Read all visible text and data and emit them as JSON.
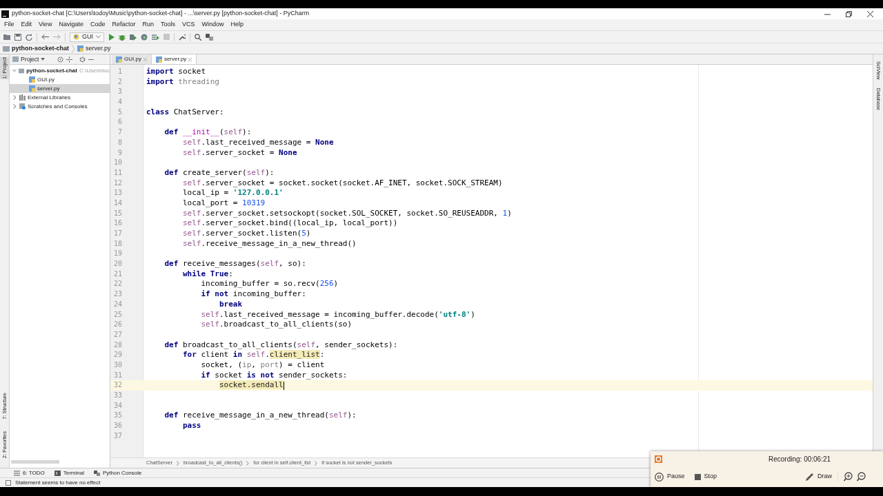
{
  "window": {
    "title": "python-socket-chat [C:\\Users\\todoy\\Music\\python-socket-chat] - ...\\server.py [python-socket-chat] - PyCharm"
  },
  "menu": [
    "File",
    "Edit",
    "View",
    "Navigate",
    "Code",
    "Refactor",
    "Run",
    "Tools",
    "VCS",
    "Window",
    "Help"
  ],
  "toolbar": {
    "run_config": "GUI"
  },
  "navigation_bar": [
    "python-socket-chat",
    "server.py"
  ],
  "left_stripe": [
    {
      "label": "1: Project",
      "selected": true
    },
    {
      "label": "7: Structure",
      "selected": false
    },
    {
      "label": "2: Favorites",
      "selected": false
    }
  ],
  "right_stripe": [
    "SciView",
    "Database"
  ],
  "project_panel": {
    "title": "Project",
    "tree": [
      {
        "label": "python-socket-chat",
        "path": "C:\\Users\\toc",
        "kind": "folder",
        "expanded": true,
        "selected": false,
        "children": [
          {
            "label": "GUI.py",
            "kind": "file",
            "selected": false
          },
          {
            "label": "server.py",
            "kind": "file",
            "selected": true
          }
        ]
      },
      {
        "label": "External Libraries",
        "kind": "libraries",
        "expanded": false,
        "selected": false
      },
      {
        "label": "Scratches and Consoles",
        "kind": "scratches",
        "expanded": false,
        "selected": false
      }
    ]
  },
  "editor_tabs": [
    {
      "label": "GUI.py",
      "selected": false
    },
    {
      "label": "server.py",
      "selected": true
    }
  ],
  "code": [
    {
      "n": "1",
      "tokens": [
        {
          "kind": "keyword",
          "text": "import"
        },
        {
          "kind": "plain",
          "text": " socket"
        }
      ]
    },
    {
      "n": "2",
      "tokens": [
        {
          "kind": "keyword",
          "text": "import"
        },
        {
          "kind": "unused",
          "text": " threading"
        }
      ]
    },
    {
      "n": "3"
    },
    {
      "n": "4"
    },
    {
      "n": "5",
      "tokens": [
        {
          "kind": "keyword",
          "text": "class"
        },
        {
          "kind": "plain",
          "text": " ChatServer:"
        }
      ]
    },
    {
      "n": "6"
    },
    {
      "n": "7",
      "tokens": [
        {
          "kind": "keyword",
          "text": "    def"
        },
        {
          "kind": "magic",
          "text": " __init__"
        },
        {
          "kind": "plain",
          "text": "("
        },
        {
          "kind": "self",
          "text": "self"
        },
        {
          "kind": "plain",
          "text": "):"
        }
      ]
    },
    {
      "n": "8",
      "tokens": [
        {
          "kind": "self",
          "text": "        self"
        },
        {
          "kind": "plain",
          "text": ".last_received_message = "
        },
        {
          "kind": "keyword",
          "text": "None"
        }
      ]
    },
    {
      "n": "9",
      "tokens": [
        {
          "kind": "self",
          "text": "        self"
        },
        {
          "kind": "plain",
          "text": ".server_socket = "
        },
        {
          "kind": "keyword",
          "text": "None"
        }
      ]
    },
    {
      "n": "10"
    },
    {
      "n": "11",
      "tokens": [
        {
          "kind": "keyword",
          "text": "    def"
        },
        {
          "kind": "plain",
          "text": " create_server("
        },
        {
          "kind": "self",
          "text": "self"
        },
        {
          "kind": "plain",
          "text": "):"
        }
      ]
    },
    {
      "n": "12",
      "tokens": [
        {
          "kind": "self",
          "text": "        self"
        },
        {
          "kind": "plain",
          "text": ".server_socket = socket.socket(socket.AF_INET, socket.SOCK_STREAM)"
        }
      ]
    },
    {
      "n": "13",
      "tokens": [
        {
          "kind": "plain",
          "text": "        local_ip = "
        },
        {
          "kind": "string",
          "text": "'127.0.0.1'"
        }
      ]
    },
    {
      "n": "14",
      "tokens": [
        {
          "kind": "plain",
          "text": "        local_port = "
        },
        {
          "kind": "number",
          "text": "10319"
        }
      ]
    },
    {
      "n": "15",
      "tokens": [
        {
          "kind": "self",
          "text": "        self"
        },
        {
          "kind": "plain",
          "text": ".server_socket.setsockopt(socket.SOL_SOCKET, socket.SO_REUSEADDR, "
        },
        {
          "kind": "number",
          "text": "1"
        },
        {
          "kind": "plain",
          "text": ")"
        }
      ]
    },
    {
      "n": "16",
      "tokens": [
        {
          "kind": "self",
          "text": "        self"
        },
        {
          "kind": "plain",
          "text": ".server_socket.bind((local_ip, local_port))"
        }
      ]
    },
    {
      "n": "17",
      "tokens": [
        {
          "kind": "self",
          "text": "        self"
        },
        {
          "kind": "plain",
          "text": ".server_socket.listen("
        },
        {
          "kind": "number",
          "text": "5"
        },
        {
          "kind": "plain",
          "text": ")"
        }
      ]
    },
    {
      "n": "18",
      "tokens": [
        {
          "kind": "self",
          "text": "        self"
        },
        {
          "kind": "plain",
          "text": ".receive_message_in_a_new_thread()"
        }
      ]
    },
    {
      "n": "19"
    },
    {
      "n": "20",
      "tokens": [
        {
          "kind": "keyword",
          "text": "    def"
        },
        {
          "kind": "plain",
          "text": " receive_messages("
        },
        {
          "kind": "self",
          "text": "self"
        },
        {
          "kind": "plain",
          "text": ", so):"
        }
      ]
    },
    {
      "n": "21",
      "tokens": [
        {
          "kind": "keyword",
          "text": "        while"
        },
        {
          "kind": "keyword",
          "text": " True"
        },
        {
          "kind": "plain",
          "text": ":"
        }
      ]
    },
    {
      "n": "22",
      "tokens": [
        {
          "kind": "plain",
          "text": "            incoming_buffer = so.recv("
        },
        {
          "kind": "number",
          "text": "256"
        },
        {
          "kind": "plain",
          "text": ")"
        }
      ]
    },
    {
      "n": "23",
      "tokens": [
        {
          "kind": "keyword",
          "text": "            if"
        },
        {
          "kind": "keyword",
          "text": " not"
        },
        {
          "kind": "plain",
          "text": " incoming_buffer:"
        }
      ]
    },
    {
      "n": "24",
      "tokens": [
        {
          "kind": "keyword",
          "text": "                break"
        }
      ]
    },
    {
      "n": "25",
      "tokens": [
        {
          "kind": "self",
          "text": "            self"
        },
        {
          "kind": "plain",
          "text": ".last_received_message = incoming_buffer.decode("
        },
        {
          "kind": "string",
          "text": "'utf-8'"
        },
        {
          "kind": "plain",
          "text": ")"
        }
      ]
    },
    {
      "n": "26",
      "tokens": [
        {
          "kind": "self",
          "text": "            self"
        },
        {
          "kind": "plain",
          "text": ".broadcast_to_all_clients(so)"
        }
      ]
    },
    {
      "n": "27"
    },
    {
      "n": "28",
      "tokens": [
        {
          "kind": "keyword",
          "text": "    def"
        },
        {
          "kind": "plain",
          "text": " broadcast_to_all_clients("
        },
        {
          "kind": "self",
          "text": "self"
        },
        {
          "kind": "plain",
          "text": ", sender_sockets):"
        }
      ]
    },
    {
      "n": "29",
      "tokens": [
        {
          "kind": "keyword",
          "text": "        for"
        },
        {
          "kind": "plain",
          "text": " client "
        },
        {
          "kind": "keyword",
          "text": "in"
        },
        {
          "kind": "self",
          "text": " self"
        },
        {
          "kind": "plain",
          "text": "."
        },
        {
          "kind": "highlight",
          "text": "client_list"
        },
        {
          "kind": "plain",
          "text": ":"
        }
      ]
    },
    {
      "n": "30",
      "tokens": [
        {
          "kind": "plain",
          "text": "            socket, ("
        },
        {
          "kind": "unused",
          "text": "ip"
        },
        {
          "kind": "plain",
          "text": ", "
        },
        {
          "kind": "unused",
          "text": "port"
        },
        {
          "kind": "plain",
          "text": ") = client"
        }
      ]
    },
    {
      "n": "31",
      "tokens": [
        {
          "kind": "keyword",
          "text": "            if"
        },
        {
          "kind": "plain",
          "text": " socket "
        },
        {
          "kind": "keyword",
          "text": "is"
        },
        {
          "kind": "keyword",
          "text": " not"
        },
        {
          "kind": "plain",
          "text": " sender_sockets:"
        }
      ]
    },
    {
      "n": "32",
      "current": true,
      "tokens": [
        {
          "kind": "highlight",
          "text": "                socket.sendall"
        }
      ]
    },
    {
      "n": "33"
    },
    {
      "n": "34"
    },
    {
      "n": "35",
      "tokens": [
        {
          "kind": "keyword",
          "text": "    def"
        },
        {
          "kind": "plain",
          "text": " receive_message_in_a_new_thread("
        },
        {
          "kind": "self",
          "text": "self"
        },
        {
          "kind": "plain",
          "text": "):"
        }
      ]
    },
    {
      "n": "36",
      "tokens": [
        {
          "kind": "keyword",
          "text": "        pass"
        }
      ]
    },
    {
      "n": "37"
    }
  ],
  "breadcrumbs": [
    "ChatServer",
    "broadcast_to_all_clients()",
    "for client in self.client_list",
    "if socket is not sender_sockets"
  ],
  "tool_windows": [
    {
      "label": "6: TODO",
      "kind": "todo"
    },
    {
      "label": "Terminal",
      "kind": "terminal"
    },
    {
      "label": "Python Console",
      "kind": "console"
    }
  ],
  "status_bar": {
    "message": "Statement seems to have no effect"
  },
  "recorder": {
    "status": "Recording: 00:06:21",
    "buttons": [
      {
        "label": "Pause",
        "kind": "pause"
      },
      {
        "label": "Stop",
        "kind": "stop"
      },
      {
        "label": "Draw",
        "kind": "draw"
      }
    ]
  }
}
